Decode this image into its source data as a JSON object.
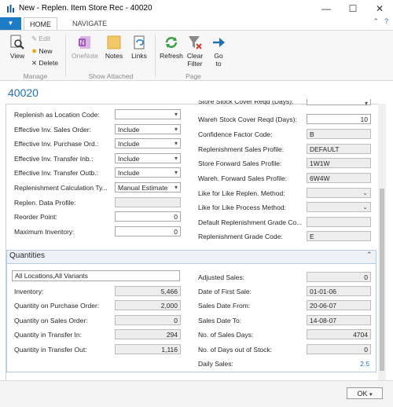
{
  "window": {
    "title": "New - Replen. Item Store Rec - 40020",
    "minimize_glyph": "—",
    "maximize_glyph": "☐",
    "close_glyph": "✕"
  },
  "ribbon": {
    "tabs": [
      "HOME",
      "NAVIGATE"
    ],
    "active_tab": "HOME",
    "manage": {
      "group_label": "Manage",
      "view": "View",
      "edit": "Edit",
      "new": "New",
      "delete": "Delete"
    },
    "show_attached": {
      "group_label": "Show Attached",
      "onenote": "OneNote",
      "notes": "Notes",
      "links": "Links"
    },
    "page": {
      "group_label": "Page",
      "refresh": "Refresh",
      "clear_filter_1": "Clear",
      "clear_filter_2": "Filter",
      "goto_1": "Go",
      "goto_2": "to"
    }
  },
  "page_title": "40020",
  "left_fields": [
    {
      "label": "Replenish as Location Code:",
      "value": "",
      "type": "dropdown"
    },
    {
      "label": "Effective Inv. Sales Order:",
      "value": "Include",
      "type": "dropdown"
    },
    {
      "label": "Effective Inv. Purchase Ord.:",
      "value": "Include",
      "type": "dropdown"
    },
    {
      "label": "Effective Inv. Transfer Inb.:",
      "value": "Include",
      "type": "dropdown"
    },
    {
      "label": "Effective Inv. Transfer Outb.:",
      "value": "Include",
      "type": "dropdown"
    },
    {
      "label": "Replenishment Calculation Ty...",
      "value": "Manual Estimate",
      "type": "dropdown"
    },
    {
      "label": "Replen. Data Profile:",
      "value": "",
      "type": "readonly"
    },
    {
      "label": "Reorder Point:",
      "value": "0",
      "type": "number"
    },
    {
      "label": "Maximum Inventory:",
      "value": "0",
      "type": "number"
    }
  ],
  "right_fields": [
    {
      "label": "Wareh Stock Cover Reqd (Days):",
      "value": "10",
      "type": "number"
    },
    {
      "label": "Confidence Factor Code:",
      "value": "B",
      "type": "readonly"
    },
    {
      "label": "Replenishment Sales Profile:",
      "value": "DEFAULT",
      "type": "readonly"
    },
    {
      "label": "Store Forward Sales Profile:",
      "value": "1W1W",
      "type": "readonly"
    },
    {
      "label": "Wareh. Forward Sales Profile:",
      "value": "6W4W",
      "type": "readonly"
    },
    {
      "label": "Like for Like Replen. Method:",
      "value": "",
      "type": "dropdown-ro"
    },
    {
      "label": "Like for Like Process Method:",
      "value": "",
      "type": "dropdown-ro"
    },
    {
      "label": "Default Replenishment Grade Co...",
      "value": "",
      "type": "readonly"
    },
    {
      "label": "Replenishment Grade Code:",
      "value": "E",
      "type": "readonly"
    }
  ],
  "top_partial_label": "Store Stock Cover Reqd (Days):",
  "quantities": {
    "title": "Quantities",
    "filter_value": "All Locations,All Variants",
    "left": [
      {
        "label": "Inventory:",
        "value": "5,466"
      },
      {
        "label": "Quantity on Purchase Order:",
        "value": "2,000"
      },
      {
        "label": "Quantity on Sales Order:",
        "value": "0"
      },
      {
        "label": "Quantity in Transfer In:",
        "value": "294"
      },
      {
        "label": "Quantity in Transfer Out:",
        "value": "1,116"
      }
    ],
    "right": [
      {
        "label": "Adjusted Sales:",
        "value": "0"
      },
      {
        "label": "Date of First Sale:",
        "value": "01-01-06"
      },
      {
        "label": "Sales Date From:",
        "value": "20-06-07"
      },
      {
        "label": "Sales Date To:",
        "value": "14-08-07"
      },
      {
        "label": "No. of Sales Days:",
        "value": "4704"
      },
      {
        "label": "No. of Days out of Stock:",
        "value": "0"
      },
      {
        "label": "Daily Sales:",
        "value": "2.5"
      }
    ]
  },
  "footer": {
    "ok": "OK"
  },
  "colors": {
    "accent": "#1e7bc6",
    "link": "#1e6fb5"
  }
}
